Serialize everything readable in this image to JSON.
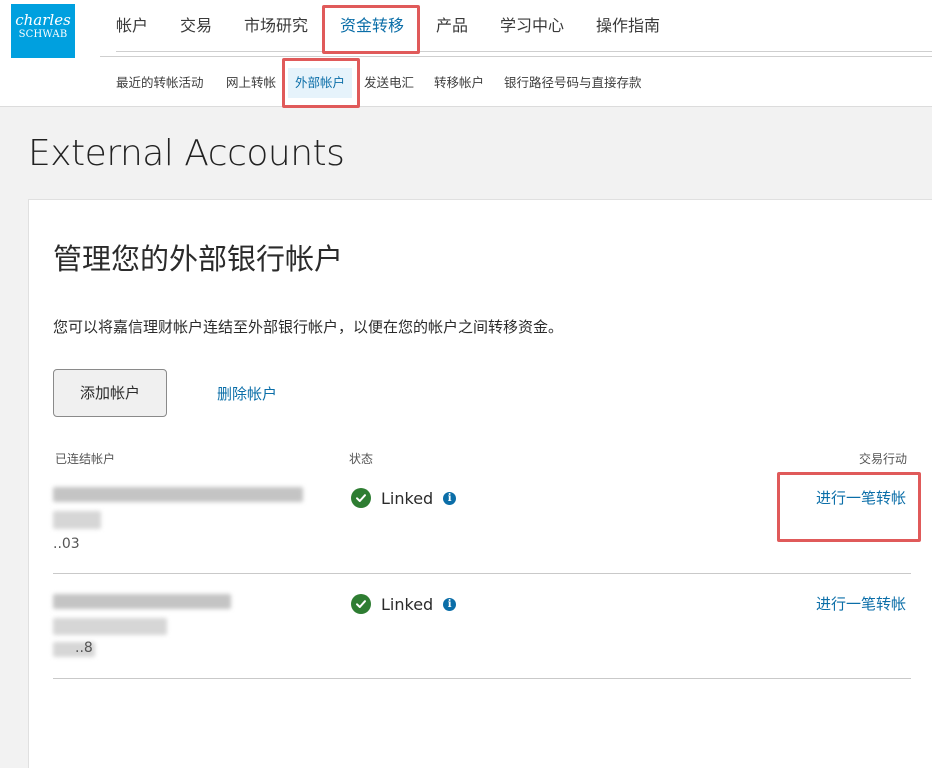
{
  "brand": {
    "line1": "charles",
    "line2": "SCHWAB"
  },
  "main_nav": [
    {
      "label": "帐户"
    },
    {
      "label": "交易"
    },
    {
      "label": "市场研究"
    },
    {
      "label": "资金转移"
    },
    {
      "label": "产品"
    },
    {
      "label": "学习中心"
    },
    {
      "label": "操作指南"
    }
  ],
  "sub_nav": [
    {
      "label": "最近的转帐活动"
    },
    {
      "label": "网上转帐"
    },
    {
      "label": "外部帐户"
    },
    {
      "label": "发送电汇"
    },
    {
      "label": "转移帐户"
    },
    {
      "label": "银行路径号码与直接存款"
    }
  ],
  "page": {
    "title": "External Accounts"
  },
  "card": {
    "title": "管理您的外部银行帐户",
    "description": "您可以将嘉信理财帐户连结至外部银行帐户，以便在您的帐户之间转移资金。",
    "add_button": "添加帐户",
    "remove_link": "删除帐户"
  },
  "table": {
    "headers": {
      "account": "已连结帐户",
      "status": "状态",
      "action": "交易行动"
    },
    "rows": [
      {
        "account_suffix": "..03",
        "status": "Linked",
        "action": "进行一笔转帐"
      },
      {
        "account_suffix": "..8",
        "status": "Linked",
        "action": "进行一笔转帐"
      }
    ]
  },
  "colors": {
    "brand": "#00a0df",
    "link": "#0b6ea8",
    "success": "#2e7d32",
    "highlight": "#e05a5a"
  }
}
